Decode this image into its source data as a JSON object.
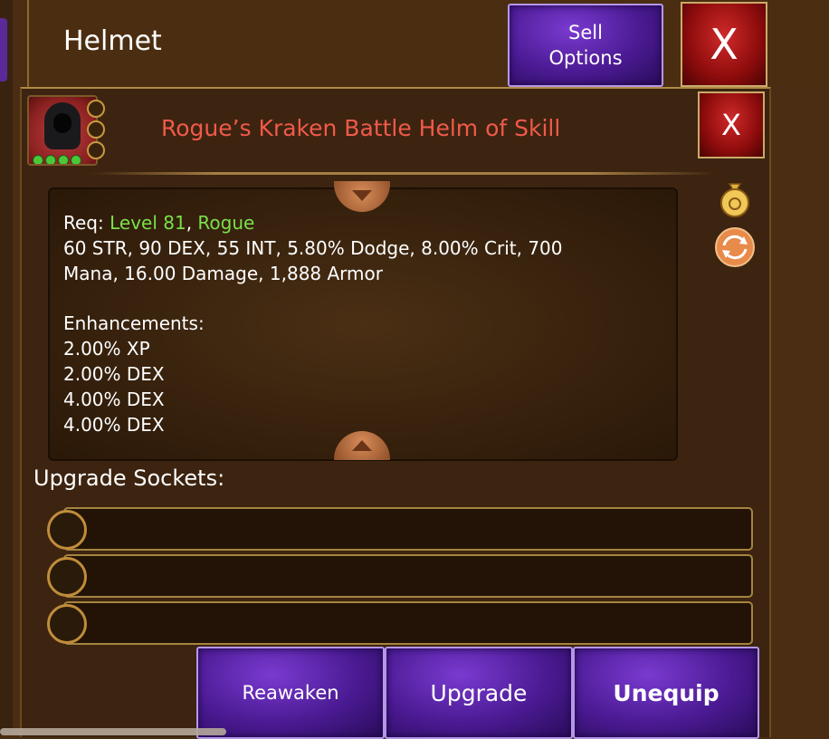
{
  "header": {
    "title": "Helmet",
    "sell_options_label": "Sell\nOptions",
    "close_label": "X"
  },
  "item": {
    "name": "Rogue’s Kraken Battle Helm of Skill",
    "close_label": "X",
    "stars": 4,
    "portrait_icon": "hooded-rogue-icon"
  },
  "stats": {
    "req_prefix": "Req: ",
    "req_level": "Level 81",
    "req_sep": ", ",
    "req_class": "Rogue",
    "line1": "60 STR, 90 DEX, 55 INT, 5.80% Dodge, 8.00% Crit, 700",
    "line2": "Mana, 16.00 Damage, 1,888 Armor",
    "enh_title": "Enhancements:",
    "enh1": "2.00% XP",
    "enh2": "2.00% DEX",
    "enh3": "4.00% DEX",
    "enh4": "4.00% DEX"
  },
  "sockets": {
    "label": "Upgrade Sockets:",
    "count": 3
  },
  "actions": {
    "reawaken": "Reawaken",
    "upgrade": "Upgrade",
    "unequip": "Unequip"
  },
  "colors": {
    "item_name": "#f05a4a",
    "requirement_ok": "#7ae04a",
    "button_purple": "#4a1a92",
    "button_red": "#8e0c0c"
  }
}
